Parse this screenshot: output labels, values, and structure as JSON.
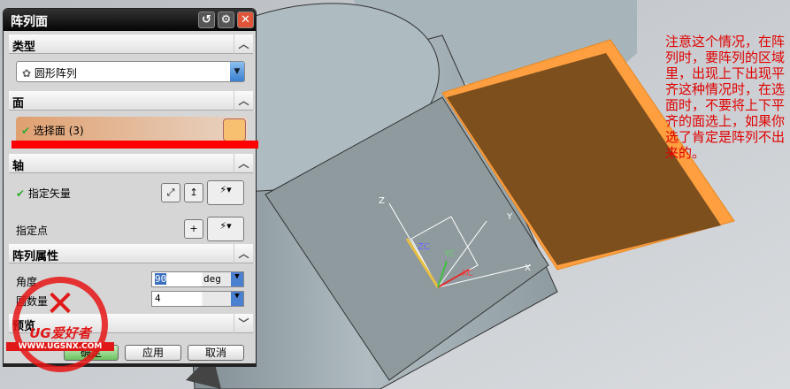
{
  "dialog": {
    "title": "阵列面",
    "reset_icon": "reset-icon",
    "settings_icon": "gear-icon",
    "close_icon": "close-icon"
  },
  "type_section": {
    "label": "类型",
    "selected": "圆形阵列"
  },
  "face_section": {
    "label": "面",
    "select_face": "选择面 (3)"
  },
  "axis_section": {
    "label": "轴",
    "vector": "指定矢量",
    "point": "指定点"
  },
  "props_section": {
    "label": "阵列属性",
    "angle_label": "角度",
    "angle_value": "90",
    "angle_unit": "deg",
    "count_label": "圆数量",
    "count_value": "4"
  },
  "preview_section": {
    "label": "预览"
  },
  "buttons": {
    "ok": "确定",
    "apply": "应用",
    "cancel": "取消"
  },
  "watermark": {
    "brand": "UG爱好者",
    "url": "WWW.UGSNX.COM"
  },
  "axes": {
    "z": "Z",
    "zc": "ZC",
    "yc": "YC",
    "xc": "XC",
    "y": "Y",
    "x": "X"
  },
  "annotation": "注意这个情况，在阵列时，要阵列的区域里，出现上下出现平齐这种情况时，在选面时，不要将上下平齐的面选上，如果你选了肯定是阵列不出来的。"
}
